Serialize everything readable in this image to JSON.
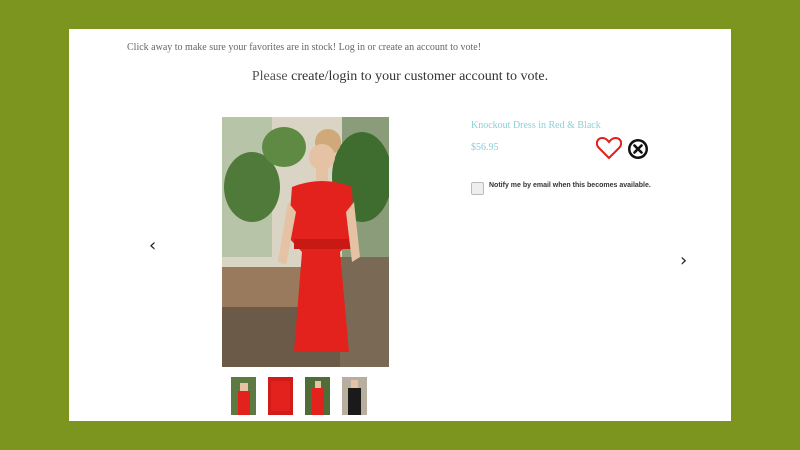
{
  "intro_text": "Click away to make sure your favorites are in stock! Log in or create an account to vote!",
  "login_message": {
    "prefix": "Please ",
    "link": "create/login to your customer account to vote."
  },
  "product": {
    "title": "Knockout Dress in Red & Black",
    "price": "$56.95",
    "notify_label": "Notify me by email when this becomes available.",
    "notify_checked": false
  },
  "colors": {
    "background": "#7b951e",
    "accent_text": "#8ccfd6",
    "heart": "#e0201b"
  },
  "icons": {
    "prev": "chevron-left-icon",
    "next": "chevron-right-icon",
    "favorite": "heart-icon",
    "dismiss": "close-circle-icon"
  },
  "nav": {
    "prev_glyph": "‹",
    "next_glyph": "›"
  },
  "thumbnails": [
    {
      "name": "red dress front"
    },
    {
      "name": "red dress closeup"
    },
    {
      "name": "red dress full"
    },
    {
      "name": "black dress"
    }
  ]
}
